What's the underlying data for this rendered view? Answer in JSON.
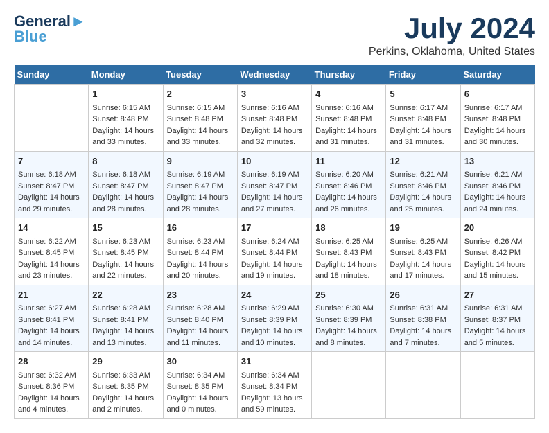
{
  "header": {
    "logo_line1": "General",
    "logo_line2": "Blue",
    "month_title": "July 2024",
    "location": "Perkins, Oklahoma, United States"
  },
  "days_of_week": [
    "Sunday",
    "Monday",
    "Tuesday",
    "Wednesday",
    "Thursday",
    "Friday",
    "Saturday"
  ],
  "weeks": [
    [
      {
        "day": "",
        "sunrise": "",
        "sunset": "",
        "daylight": ""
      },
      {
        "day": "1",
        "sunrise": "Sunrise: 6:15 AM",
        "sunset": "Sunset: 8:48 PM",
        "daylight": "Daylight: 14 hours and 33 minutes."
      },
      {
        "day": "2",
        "sunrise": "Sunrise: 6:15 AM",
        "sunset": "Sunset: 8:48 PM",
        "daylight": "Daylight: 14 hours and 33 minutes."
      },
      {
        "day": "3",
        "sunrise": "Sunrise: 6:16 AM",
        "sunset": "Sunset: 8:48 PM",
        "daylight": "Daylight: 14 hours and 32 minutes."
      },
      {
        "day": "4",
        "sunrise": "Sunrise: 6:16 AM",
        "sunset": "Sunset: 8:48 PM",
        "daylight": "Daylight: 14 hours and 31 minutes."
      },
      {
        "day": "5",
        "sunrise": "Sunrise: 6:17 AM",
        "sunset": "Sunset: 8:48 PM",
        "daylight": "Daylight: 14 hours and 31 minutes."
      },
      {
        "day": "6",
        "sunrise": "Sunrise: 6:17 AM",
        "sunset": "Sunset: 8:48 PM",
        "daylight": "Daylight: 14 hours and 30 minutes."
      }
    ],
    [
      {
        "day": "7",
        "sunrise": "Sunrise: 6:18 AM",
        "sunset": "Sunset: 8:47 PM",
        "daylight": "Daylight: 14 hours and 29 minutes."
      },
      {
        "day": "8",
        "sunrise": "Sunrise: 6:18 AM",
        "sunset": "Sunset: 8:47 PM",
        "daylight": "Daylight: 14 hours and 28 minutes."
      },
      {
        "day": "9",
        "sunrise": "Sunrise: 6:19 AM",
        "sunset": "Sunset: 8:47 PM",
        "daylight": "Daylight: 14 hours and 28 minutes."
      },
      {
        "day": "10",
        "sunrise": "Sunrise: 6:19 AM",
        "sunset": "Sunset: 8:47 PM",
        "daylight": "Daylight: 14 hours and 27 minutes."
      },
      {
        "day": "11",
        "sunrise": "Sunrise: 6:20 AM",
        "sunset": "Sunset: 8:46 PM",
        "daylight": "Daylight: 14 hours and 26 minutes."
      },
      {
        "day": "12",
        "sunrise": "Sunrise: 6:21 AM",
        "sunset": "Sunset: 8:46 PM",
        "daylight": "Daylight: 14 hours and 25 minutes."
      },
      {
        "day": "13",
        "sunrise": "Sunrise: 6:21 AM",
        "sunset": "Sunset: 8:46 PM",
        "daylight": "Daylight: 14 hours and 24 minutes."
      }
    ],
    [
      {
        "day": "14",
        "sunrise": "Sunrise: 6:22 AM",
        "sunset": "Sunset: 8:45 PM",
        "daylight": "Daylight: 14 hours and 23 minutes."
      },
      {
        "day": "15",
        "sunrise": "Sunrise: 6:23 AM",
        "sunset": "Sunset: 8:45 PM",
        "daylight": "Daylight: 14 hours and 22 minutes."
      },
      {
        "day": "16",
        "sunrise": "Sunrise: 6:23 AM",
        "sunset": "Sunset: 8:44 PM",
        "daylight": "Daylight: 14 hours and 20 minutes."
      },
      {
        "day": "17",
        "sunrise": "Sunrise: 6:24 AM",
        "sunset": "Sunset: 8:44 PM",
        "daylight": "Daylight: 14 hours and 19 minutes."
      },
      {
        "day": "18",
        "sunrise": "Sunrise: 6:25 AM",
        "sunset": "Sunset: 8:43 PM",
        "daylight": "Daylight: 14 hours and 18 minutes."
      },
      {
        "day": "19",
        "sunrise": "Sunrise: 6:25 AM",
        "sunset": "Sunset: 8:43 PM",
        "daylight": "Daylight: 14 hours and 17 minutes."
      },
      {
        "day": "20",
        "sunrise": "Sunrise: 6:26 AM",
        "sunset": "Sunset: 8:42 PM",
        "daylight": "Daylight: 14 hours and 15 minutes."
      }
    ],
    [
      {
        "day": "21",
        "sunrise": "Sunrise: 6:27 AM",
        "sunset": "Sunset: 8:41 PM",
        "daylight": "Daylight: 14 hours and 14 minutes."
      },
      {
        "day": "22",
        "sunrise": "Sunrise: 6:28 AM",
        "sunset": "Sunset: 8:41 PM",
        "daylight": "Daylight: 14 hours and 13 minutes."
      },
      {
        "day": "23",
        "sunrise": "Sunrise: 6:28 AM",
        "sunset": "Sunset: 8:40 PM",
        "daylight": "Daylight: 14 hours and 11 minutes."
      },
      {
        "day": "24",
        "sunrise": "Sunrise: 6:29 AM",
        "sunset": "Sunset: 8:39 PM",
        "daylight": "Daylight: 14 hours and 10 minutes."
      },
      {
        "day": "25",
        "sunrise": "Sunrise: 6:30 AM",
        "sunset": "Sunset: 8:39 PM",
        "daylight": "Daylight: 14 hours and 8 minutes."
      },
      {
        "day": "26",
        "sunrise": "Sunrise: 6:31 AM",
        "sunset": "Sunset: 8:38 PM",
        "daylight": "Daylight: 14 hours and 7 minutes."
      },
      {
        "day": "27",
        "sunrise": "Sunrise: 6:31 AM",
        "sunset": "Sunset: 8:37 PM",
        "daylight": "Daylight: 14 hours and 5 minutes."
      }
    ],
    [
      {
        "day": "28",
        "sunrise": "Sunrise: 6:32 AM",
        "sunset": "Sunset: 8:36 PM",
        "daylight": "Daylight: 14 hours and 4 minutes."
      },
      {
        "day": "29",
        "sunrise": "Sunrise: 6:33 AM",
        "sunset": "Sunset: 8:35 PM",
        "daylight": "Daylight: 14 hours and 2 minutes."
      },
      {
        "day": "30",
        "sunrise": "Sunrise: 6:34 AM",
        "sunset": "Sunset: 8:35 PM",
        "daylight": "Daylight: 14 hours and 0 minutes."
      },
      {
        "day": "31",
        "sunrise": "Sunrise: 6:34 AM",
        "sunset": "Sunset: 8:34 PM",
        "daylight": "Daylight: 13 hours and 59 minutes."
      },
      {
        "day": "",
        "sunrise": "",
        "sunset": "",
        "daylight": ""
      },
      {
        "day": "",
        "sunrise": "",
        "sunset": "",
        "daylight": ""
      },
      {
        "day": "",
        "sunrise": "",
        "sunset": "",
        "daylight": ""
      }
    ]
  ]
}
